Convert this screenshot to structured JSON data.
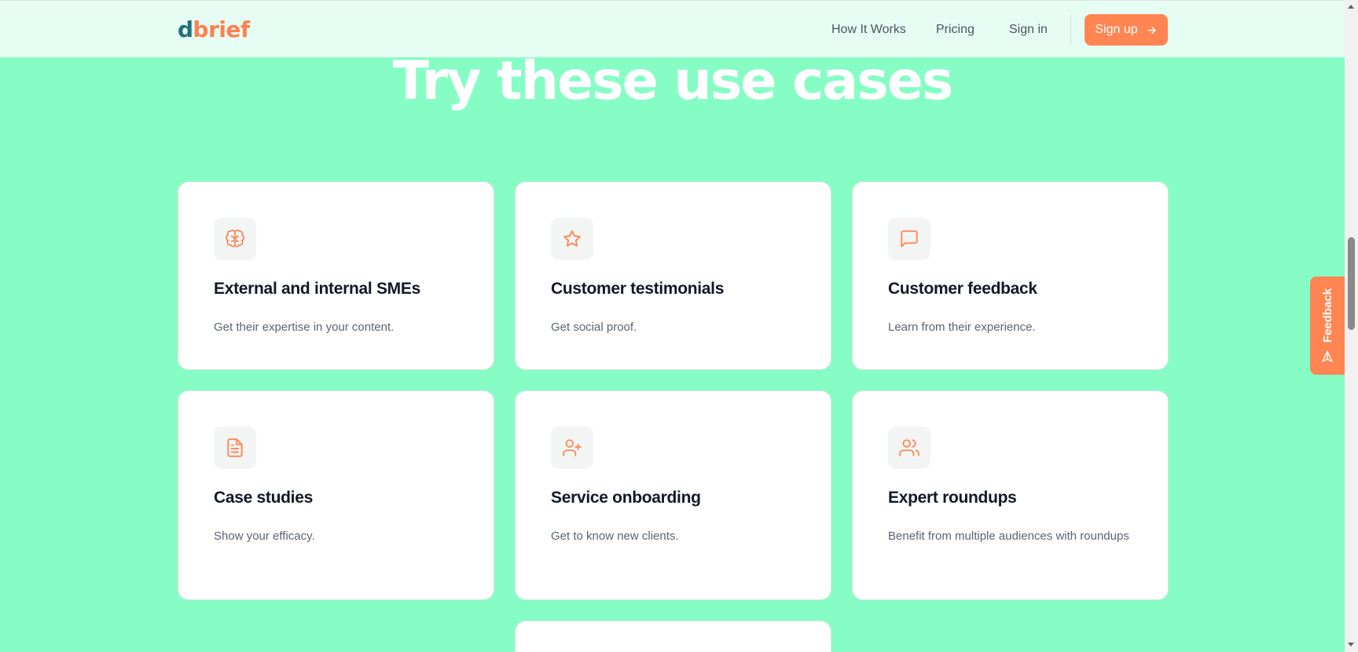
{
  "header": {
    "logo_d": "d",
    "logo_rest": "brief",
    "nav": {
      "how_it_works": "How It Works",
      "pricing": "Pricing",
      "sign_in": "Sign in"
    },
    "signup_label": "Sign up"
  },
  "hero": {
    "title": "Try these use cases"
  },
  "cards": [
    {
      "icon": "brain-icon",
      "title": "External and internal SMEs",
      "desc": "Get their expertise in your content."
    },
    {
      "icon": "star-icon",
      "title": "Customer testimonials",
      "desc": "Get social proof."
    },
    {
      "icon": "message-square-icon",
      "title": "Customer feedback",
      "desc": "Learn from their experience."
    },
    {
      "icon": "file-text-icon",
      "title": "Case studies",
      "desc": "Show your efficacy."
    },
    {
      "icon": "user-plus-icon",
      "title": "Service onboarding",
      "desc": "Get to know new clients."
    },
    {
      "icon": "users-icon",
      "title": "Expert roundups",
      "desc": "Benefit from multiple audiences with roundups"
    }
  ],
  "feedback": {
    "label": "Feedback"
  },
  "colors": {
    "page_bg": "#86fdc5",
    "header_bg": "#e6fdf3",
    "accent": "#ff8552",
    "logo_d": "#1f6f7a"
  }
}
